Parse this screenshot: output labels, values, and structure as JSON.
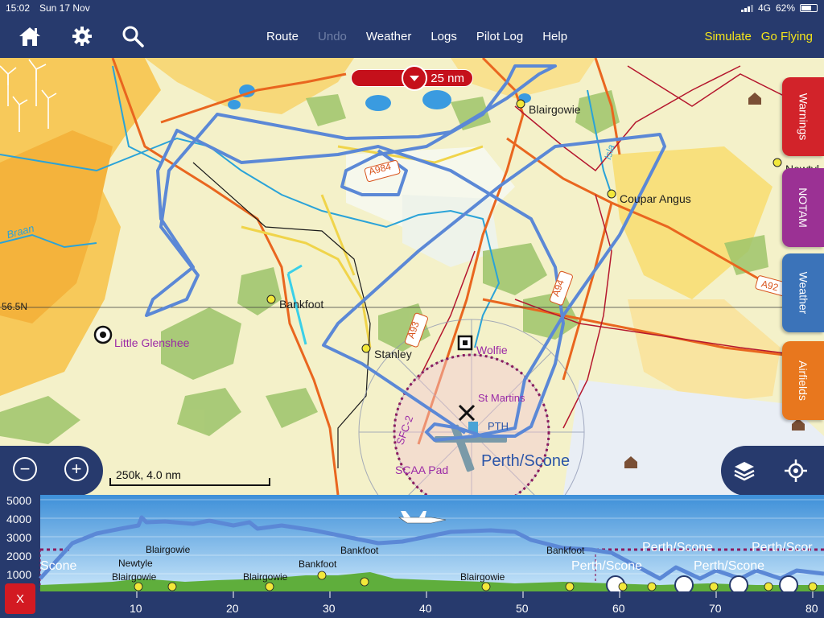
{
  "status": {
    "time": "15:02",
    "date": "Sun 17 Nov",
    "network": "4G",
    "battery": "62%"
  },
  "toolbar": {
    "home_icon": "home-icon",
    "settings_icon": "gear-icon",
    "search_icon": "search-icon",
    "menu": [
      "Route",
      "Undo",
      "Weather",
      "Logs",
      "Pilot Log",
      "Help"
    ],
    "disabled": [
      "Undo"
    ],
    "actions": [
      "Simulate",
      "Go Flying"
    ]
  },
  "map": {
    "range_label": "25 nm",
    "latitude_label": "56.5N",
    "scale_label": "250k, 4.0 nm",
    "places": [
      {
        "name": "Blairgowie",
        "kind": "town"
      },
      {
        "name": "Coupar Angus",
        "kind": "town"
      },
      {
        "name": "Bankfoot",
        "kind": "town"
      },
      {
        "name": "Stanley",
        "kind": "town"
      },
      {
        "name": "Little Glenshee",
        "kind": "airfield"
      },
      {
        "name": "Wolfie",
        "kind": "waypoint"
      },
      {
        "name": "St Martins",
        "kind": "reporting-point"
      },
      {
        "name": "SCAA Pad",
        "kind": "airfield"
      },
      {
        "name": "Perth/Scone",
        "kind": "airfield"
      },
      {
        "name": "Braan",
        "kind": "river"
      },
      {
        "name": "Isla",
        "kind": "river"
      },
      {
        "name": "Newtyl",
        "kind": "town"
      },
      {
        "name": "PTH",
        "kind": "navaid"
      }
    ],
    "roads": [
      "A984",
      "A93",
      "A94",
      "A92"
    ],
    "airspace_label": "SFC-2",
    "side_tabs": [
      {
        "label": "Warnings",
        "color": "#d2232a"
      },
      {
        "label": "NOTAM",
        "color": "#9b3194"
      },
      {
        "label": "Weather",
        "color": "#3b73b9"
      },
      {
        "label": "Airfields",
        "color": "#e8771e"
      }
    ]
  },
  "profile": {
    "y_ticks": [
      "5000",
      "4000",
      "3000",
      "2000",
      "1000"
    ],
    "x_ticks": [
      "10",
      "20",
      "30",
      "40",
      "50",
      "60",
      "70",
      "80"
    ],
    "labels": [
      "Blairgowie",
      "Newtyle",
      "Blairgowie",
      "Bankfoot",
      "Bankfoot",
      "Blairgowie",
      "Blairgowie",
      "Bankfoot",
      "Perth/Scone",
      "Perth/Scone",
      "Perth/Scone",
      "Perth/Scor",
      "Scone"
    ],
    "close_label": "X"
  }
}
